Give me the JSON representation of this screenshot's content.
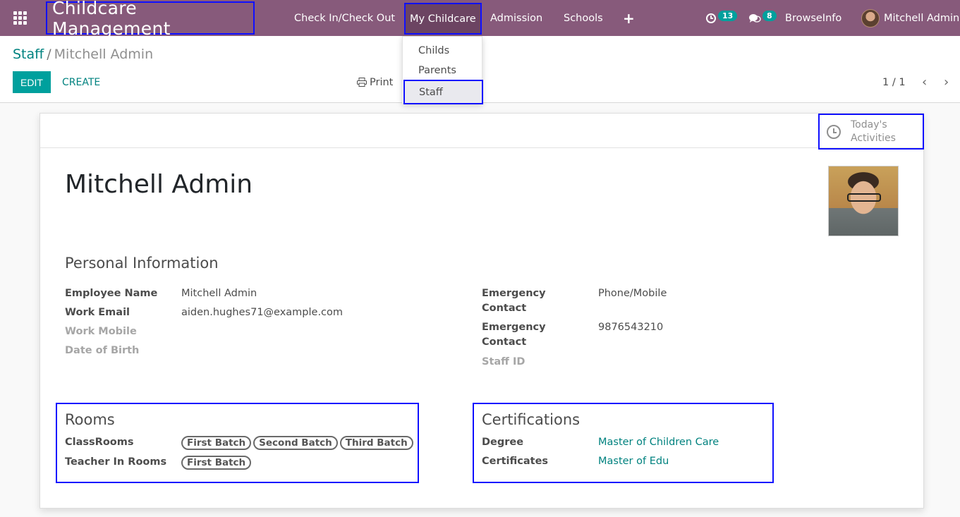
{
  "navbar": {
    "brand": "Childcare Management",
    "menu": [
      "Check In/Check Out",
      "My Childcare",
      "Admission",
      "Schools"
    ],
    "plus": "+",
    "activity_count": "13",
    "message_count": "8",
    "company": "BrowseInfo",
    "user": "Mitchell Admin"
  },
  "dropdown": {
    "items": [
      "Childs",
      "Parents",
      "Staff"
    ]
  },
  "breadcrumb": {
    "parent": "Staff",
    "separator": "/",
    "current": "Mitchell Admin"
  },
  "toolbar": {
    "edit": "EDIT",
    "create": "CREATE",
    "print": "Print",
    "pager": "1 / 1"
  },
  "record": {
    "activities_button": "Today's Activities",
    "name": "Mitchell Admin",
    "personal_title": "Personal Information",
    "fields_left": [
      {
        "label": "Employee Name",
        "value": "Mitchell Admin"
      },
      {
        "label": "Work Email",
        "value": "aiden.hughes71@example.com"
      },
      {
        "label": "Work Mobile",
        "value": ""
      },
      {
        "label": "Date of Birth",
        "value": ""
      }
    ],
    "fields_right": [
      {
        "label": "Emergency Contact",
        "value": "Phone/Mobile"
      },
      {
        "label": "Emergency Contact",
        "value": "9876543210"
      },
      {
        "label": "Staff ID",
        "value": ""
      }
    ],
    "rooms": {
      "title": "Rooms",
      "classrooms_label": "ClassRooms",
      "classrooms": [
        "First Batch",
        "Second Batch",
        "Third Batch"
      ],
      "teacher_label": "Teacher In Rooms",
      "teacher_rooms": [
        "First Batch"
      ]
    },
    "certifications": {
      "title": "Certifications",
      "degree_label": "Degree",
      "degree": "Master of Children Care",
      "certificates_label": "Certificates",
      "certificates": "Master of Edu"
    }
  }
}
